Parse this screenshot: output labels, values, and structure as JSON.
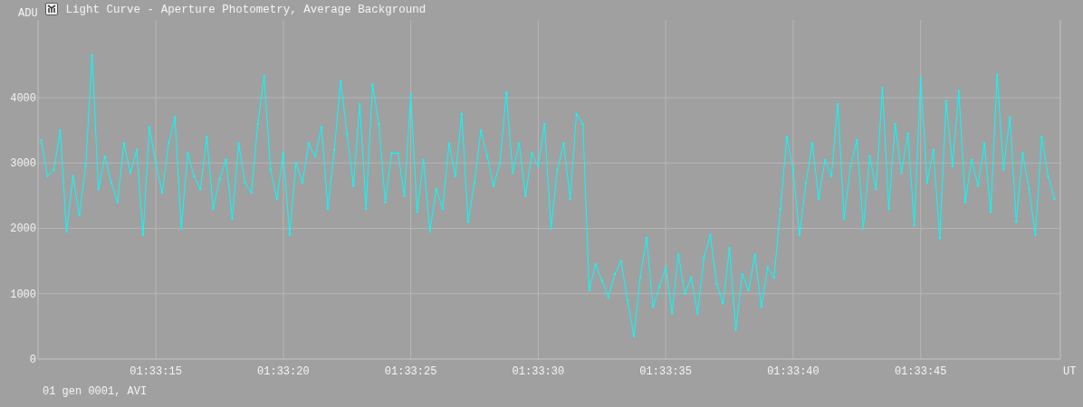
{
  "window": {
    "title": "Light Curve - Aperture Photometry, Average Background"
  },
  "chart": {
    "y_unit": "ADU",
    "x_unit": "UT",
    "footer": "01 gen 0001, AVI",
    "chart_data": {
      "type": "line",
      "grid": true,
      "ylim": [
        0,
        5190
      ],
      "xlim": [
        5590.38,
        5630.48
      ],
      "yticks": [
        0,
        1000,
        2000,
        3000,
        4000
      ],
      "xticks": [
        {
          "value": 5595,
          "label": "01:33:15"
        },
        {
          "value": 5600,
          "label": "01:33:20"
        },
        {
          "value": 5605,
          "label": "01:33:25"
        },
        {
          "value": 5610,
          "label": "01:33:30"
        },
        {
          "value": 5615,
          "label": "01:33:35"
        },
        {
          "value": 5620,
          "label": "01:33:40"
        },
        {
          "value": 5625,
          "label": "01:33:45"
        }
      ],
      "x": [
        5590.5,
        5590.75,
        5591,
        5591.25,
        5591.5,
        5591.75,
        5592,
        5592.25,
        5592.5,
        5592.75,
        5593,
        5593.25,
        5593.5,
        5593.75,
        5594,
        5594.25,
        5594.5,
        5594.75,
        5595,
        5595.25,
        5595.5,
        5595.75,
        5596,
        5596.25,
        5596.5,
        5596.75,
        5597,
        5597.25,
        5597.5,
        5597.75,
        5598,
        5598.25,
        5598.5,
        5598.75,
        5599,
        5599.25,
        5599.5,
        5599.75,
        5600,
        5600.25,
        5600.5,
        5600.75,
        5601,
        5601.25,
        5601.5,
        5601.75,
        5602,
        5602.25,
        5602.5,
        5602.75,
        5603,
        5603.25,
        5603.5,
        5603.75,
        5604,
        5604.25,
        5604.5,
        5604.75,
        5605,
        5605.25,
        5605.5,
        5605.75,
        5606,
        5606.25,
        5606.5,
        5606.75,
        5607,
        5607.25,
        5607.5,
        5607.75,
        5608,
        5608.25,
        5608.5,
        5608.75,
        5609,
        5609.25,
        5609.5,
        5609.75,
        5610,
        5610.25,
        5610.5,
        5610.75,
        5611,
        5611.25,
        5611.5,
        5611.75,
        5612,
        5612.25,
        5612.5,
        5612.75,
        5613,
        5613.25,
        5613.5,
        5613.75,
        5614,
        5614.25,
        5614.5,
        5614.75,
        5615,
        5615.25,
        5615.5,
        5615.75,
        5616,
        5616.25,
        5616.5,
        5616.75,
        5617,
        5617.25,
        5617.5,
        5617.75,
        5618,
        5618.25,
        5618.5,
        5618.75,
        5619,
        5619.25,
        5619.5,
        5619.75,
        5620,
        5620.25,
        5620.5,
        5620.75,
        5621,
        5621.25,
        5621.5,
        5621.75,
        5622,
        5622.25,
        5622.5,
        5622.75,
        5623,
        5623.25,
        5623.5,
        5623.75,
        5624,
        5624.25,
        5624.5,
        5624.75,
        5625,
        5625.25,
        5625.5,
        5625.75,
        5626,
        5626.25,
        5626.5,
        5626.75,
        5627,
        5627.25,
        5627.5,
        5627.75,
        5628,
        5628.25,
        5628.5,
        5628.75,
        5629,
        5629.25,
        5629.5,
        5629.75,
        5630,
        5630.25
      ],
      "series": [
        {
          "color": "#00ffff",
          "values": [
            3350,
            2800,
            2900,
            3500,
            1950,
            2800,
            2200,
            2950,
            4650,
            2600,
            3100,
            2700,
            2400,
            3300,
            2850,
            3200,
            1900,
            3550,
            3000,
            2550,
            3300,
            3700,
            2000,
            3150,
            2800,
            2600,
            3400,
            2300,
            2750,
            3050,
            2150,
            3300,
            2700,
            2550,
            3600,
            4330,
            2900,
            2450,
            3150,
            1900,
            3000,
            2700,
            3300,
            3100,
            3550,
            2300,
            3200,
            4250,
            3450,
            2650,
            3900,
            2300,
            4200,
            3600,
            2400,
            3150,
            3150,
            2500,
            4050,
            2250,
            3050,
            1950,
            2600,
            2300,
            3300,
            2800,
            3750,
            2100,
            2700,
            3500,
            3100,
            2650,
            3000,
            4080,
            2850,
            3300,
            2500,
            3150,
            2950,
            3600,
            2000,
            2900,
            3300,
            2450,
            3750,
            3600,
            1050,
            1450,
            1200,
            950,
            1300,
            1500,
            900,
            350,
            1250,
            1850,
            800,
            1100,
            1400,
            700,
            1600,
            1000,
            1250,
            700,
            1550,
            1900,
            1150,
            850,
            1700,
            450,
            1300,
            1050,
            1600,
            800,
            1400,
            1250,
            2300,
            3400,
            2900,
            1900,
            2700,
            3300,
            2450,
            3050,
            2800,
            3900,
            2150,
            2950,
            3350,
            2000,
            3100,
            2600,
            4150,
            2300,
            3600,
            2850,
            3450,
            2050,
            4300,
            2700,
            3200,
            1850,
            3950,
            2950,
            4100,
            2400,
            3050,
            2650,
            3300,
            2250,
            4350,
            2900,
            3700,
            2100,
            3150,
            2600,
            1900,
            3400,
            2800,
            2450
          ]
        }
      ]
    }
  }
}
